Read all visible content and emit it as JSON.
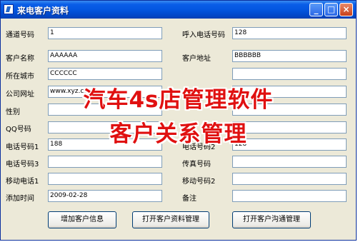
{
  "window": {
    "title": "来电客户资料"
  },
  "fields_left": [
    {
      "label": "通道号码",
      "value": "1"
    },
    {
      "label": "客户名称",
      "value": "AAAAAA"
    },
    {
      "label": "所在城市",
      "value": "CCCCCC"
    },
    {
      "label": "公司网址",
      "value": "www.xyz.com"
    },
    {
      "label": "性别",
      "value": ""
    },
    {
      "label": "QQ号码",
      "value": ""
    },
    {
      "label": "电话号码1",
      "value": "188"
    },
    {
      "label": "电话号码3",
      "value": ""
    },
    {
      "label": "移动电话1",
      "value": ""
    },
    {
      "label": "添加时间",
      "value": "2009-02-28"
    }
  ],
  "fields_right": [
    {
      "label": "呼入电话号码",
      "value": "128"
    },
    {
      "label": "客户地址",
      "value": "BBBBBB"
    },
    {
      "label": "电话号码2",
      "value": "128"
    },
    {
      "label": "传真号码",
      "value": ""
    },
    {
      "label": "移动号码2",
      "value": ""
    },
    {
      "label": "备注",
      "value": ""
    }
  ],
  "buttons": {
    "add": "增加客户信息",
    "open_customer": "打开客户资料管理",
    "open_contact": "打开客户沟通管理"
  },
  "overlay": {
    "line1": "汽车4s店管理软件",
    "line2": "客户关系管理"
  },
  "colors": {
    "overlay_text": "#e01010",
    "title_bar": "#0356e0"
  }
}
